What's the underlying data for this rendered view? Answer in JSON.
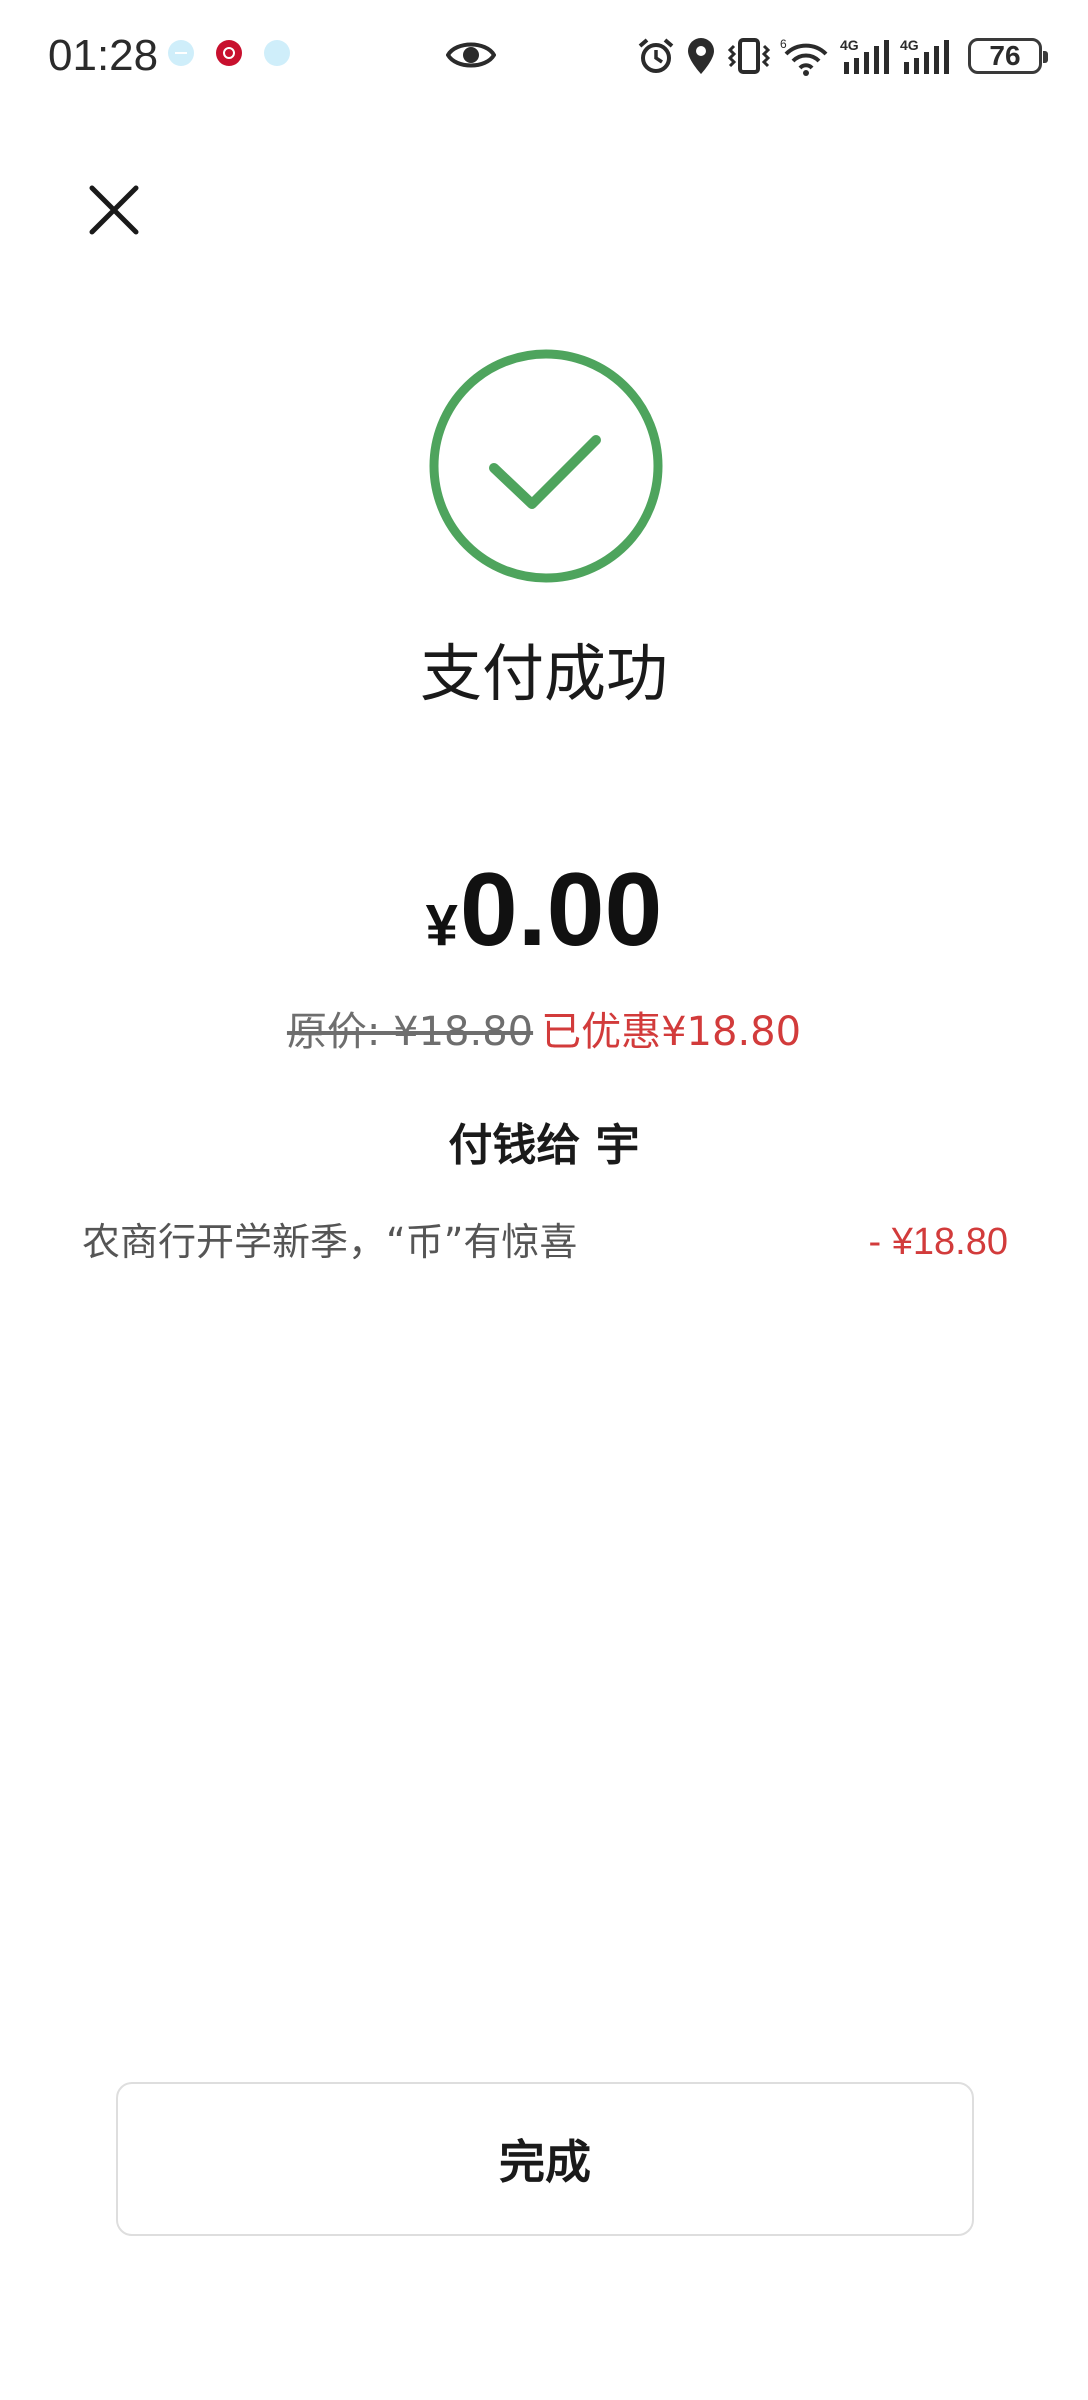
{
  "status_bar": {
    "time": "01:28",
    "battery_level": "76",
    "app_icons": [
      "circle-minus-icon",
      "bank-icon",
      "globe-icon"
    ],
    "indicators": [
      "eye-icon",
      "alarm-icon",
      "location-icon",
      "vibrate-icon",
      "wifi-icon",
      "signal-4g-icon",
      "signal-4g-icon"
    ]
  },
  "header": {
    "close_icon": "close-icon"
  },
  "result": {
    "icon": "check-circle-icon",
    "title": "支付成功",
    "accent_color": "#4ea45d"
  },
  "amount": {
    "currency": "¥",
    "value": "0.00"
  },
  "price_info": {
    "original": "原价: ¥18.80",
    "discount": "已优惠¥18.80",
    "discount_color": "#d23b3b"
  },
  "payee": {
    "label": "付钱给 宇"
  },
  "promotion": {
    "name": "农商行开学新季，“币”有惊喜",
    "amount": "- ¥18.80"
  },
  "footer": {
    "done_label": "完成"
  }
}
